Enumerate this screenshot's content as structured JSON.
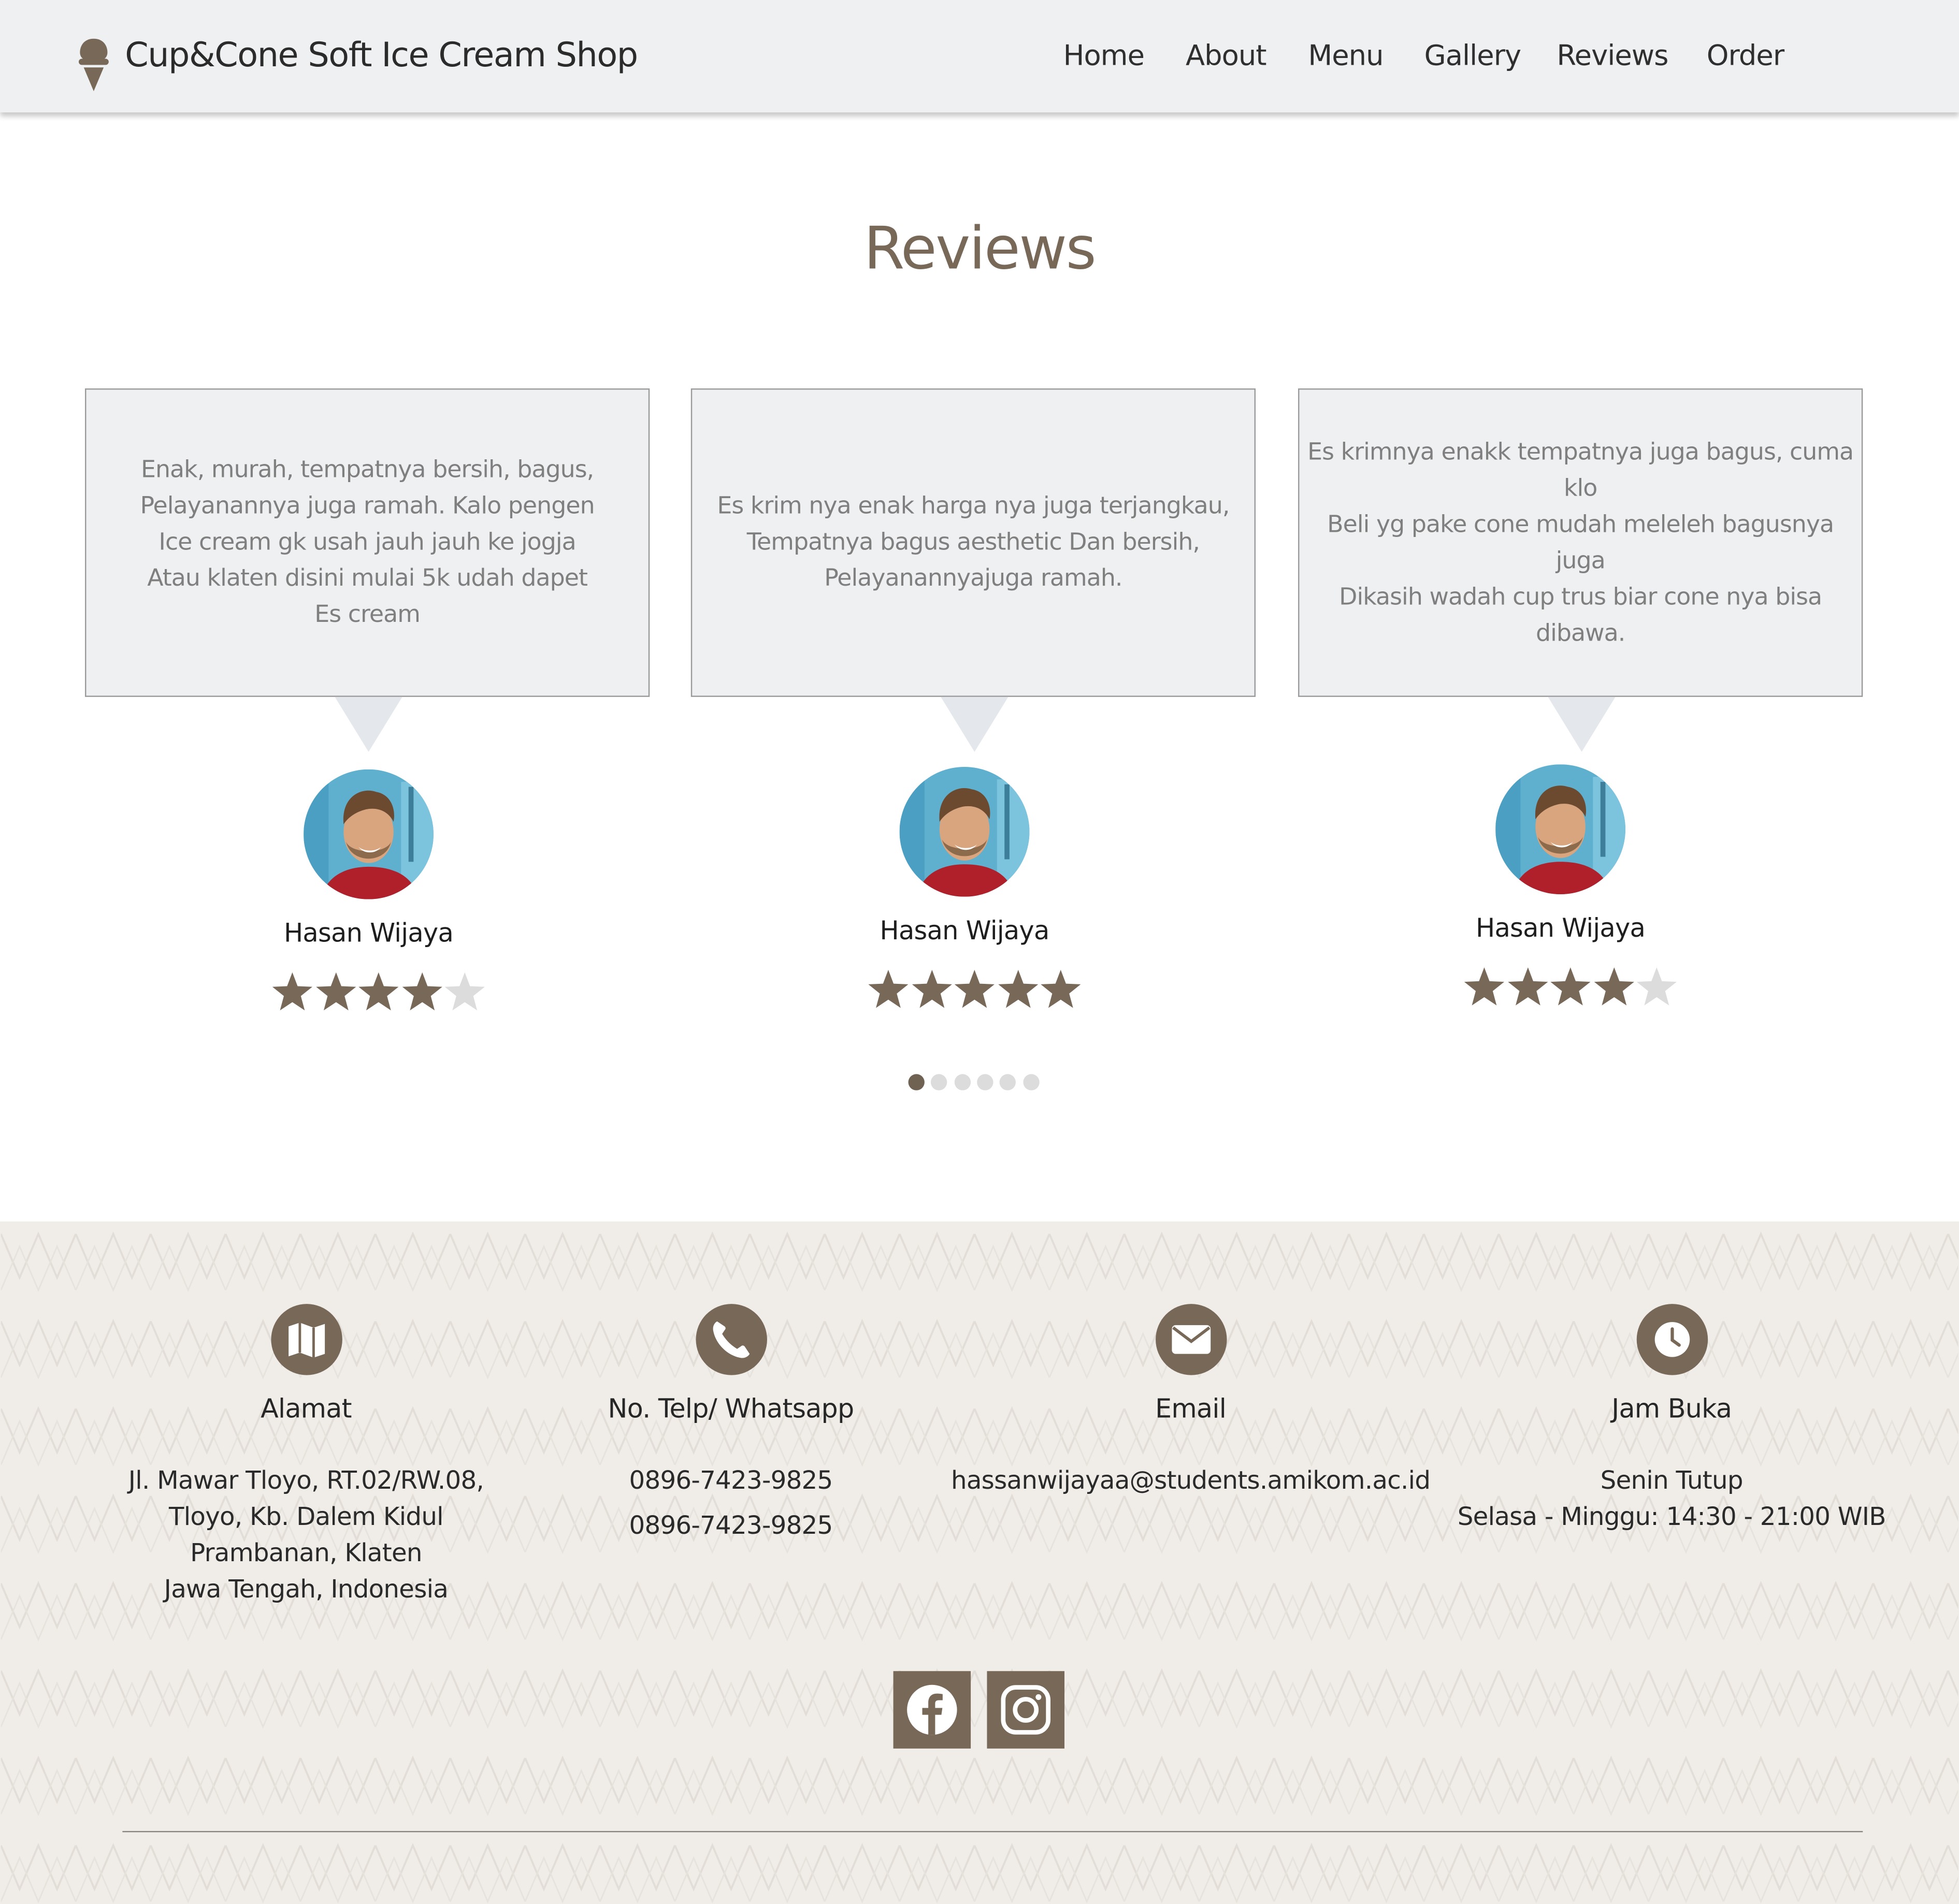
{
  "brand": {
    "name": "Cup&Cone Soft Ice Cream Shop",
    "logo": "ice-cream-cone-icon"
  },
  "nav": [
    "Home",
    "About",
    "Menu",
    "Gallery",
    "Reviews",
    "Order"
  ],
  "reviews": {
    "title": "Reviews",
    "cards": [
      {
        "text": "Enak, murah, tempatnya bersih, bagus,\nPelayanannya juga ramah. Kalo pengen\nIce cream gk usah jauh jauh ke jogja\nAtau klaten disini mulai 5k udah dapet\nEs cream",
        "name": "Hasan Wijaya",
        "rating": 4
      },
      {
        "text": "Es krim nya enak harga nya juga terjangkau,\nTempatnya bagus aesthetic Dan bersih,\nPelayanannyajuga ramah.",
        "name": "Hasan Wijaya",
        "rating": 5
      },
      {
        "text": "Es krimnya enakk tempatnya juga bagus, cuma klo\nBeli yg pake cone mudah meleleh bagusnya juga\nDikasih wadah cup trus biar cone nya bisa dibawa.",
        "name": "Hasan Wijaya",
        "rating": 4
      }
    ],
    "max_rating": 5,
    "carousel": {
      "pages": 6,
      "active": 1
    }
  },
  "footer": {
    "columns": [
      {
        "icon": "map-icon",
        "heading": "Alamat",
        "lines": [
          "Jl. Mawar Tloyo, RT.02/RW.08,",
          "Tloyo, Kb. Dalem Kidul",
          "Prambanan, Klaten",
          "Jawa Tengah, Indonesia"
        ]
      },
      {
        "icon": "phone-icon",
        "heading": "No. Telp/ Whatsapp",
        "lines": [
          "0896-7423-9825",
          "0896-7423-9825"
        ]
      },
      {
        "icon": "envelope-icon",
        "heading": "Email",
        "lines": [
          "hassanwijayaa@students.amikom.ac.id"
        ]
      },
      {
        "icon": "clock-icon",
        "heading": "Jam Buka",
        "lines": [
          "Senin Tutup",
          "Selasa - Minggu: 14:30 - 21:00 WIB"
        ]
      }
    ],
    "social": [
      "facebook-icon",
      "instagram-icon"
    ]
  },
  "colors": {
    "accent": "#776858",
    "header_bg": "#eff0f2",
    "card_bg": "#eff0f2",
    "footer_bg": "#f0ede9",
    "star_empty": "#dcdcdc"
  }
}
